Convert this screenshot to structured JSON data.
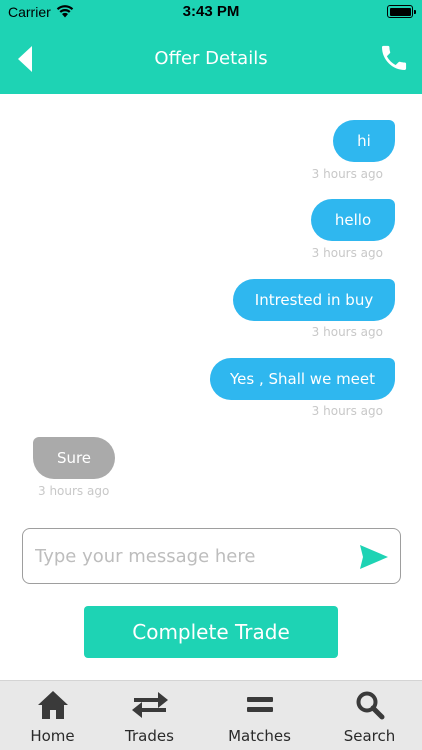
{
  "status_bar": {
    "carrier": "Carrier",
    "time": "3:43 PM"
  },
  "header": {
    "title": "Offer Details"
  },
  "messages": [
    {
      "text": "hi",
      "time": "3 hours ago",
      "side": "out"
    },
    {
      "text": "hello",
      "time": "3 hours ago",
      "side": "out"
    },
    {
      "text": "Intrested in buy",
      "time": "3 hours ago",
      "side": "out"
    },
    {
      "text": "Yes , Shall we meet",
      "time": "3 hours ago",
      "side": "out"
    },
    {
      "text": "Sure",
      "time": "3 hours ago",
      "side": "in"
    }
  ],
  "composer": {
    "placeholder": "Type your message here",
    "value": ""
  },
  "actions": {
    "complete_label": "Complete Trade"
  },
  "tabs": [
    {
      "label": "Home",
      "icon": "home-icon"
    },
    {
      "label": "Trades",
      "icon": "swap-arrows-icon"
    },
    {
      "label": "Matches",
      "icon": "equals-icon"
    },
    {
      "label": "Search",
      "icon": "search-icon"
    }
  ],
  "colors": {
    "primary": "#1ed3b4",
    "outgoing": "#2fb7ef",
    "incoming": "#aaaaaa",
    "timestamp": "#c8c8c8"
  }
}
